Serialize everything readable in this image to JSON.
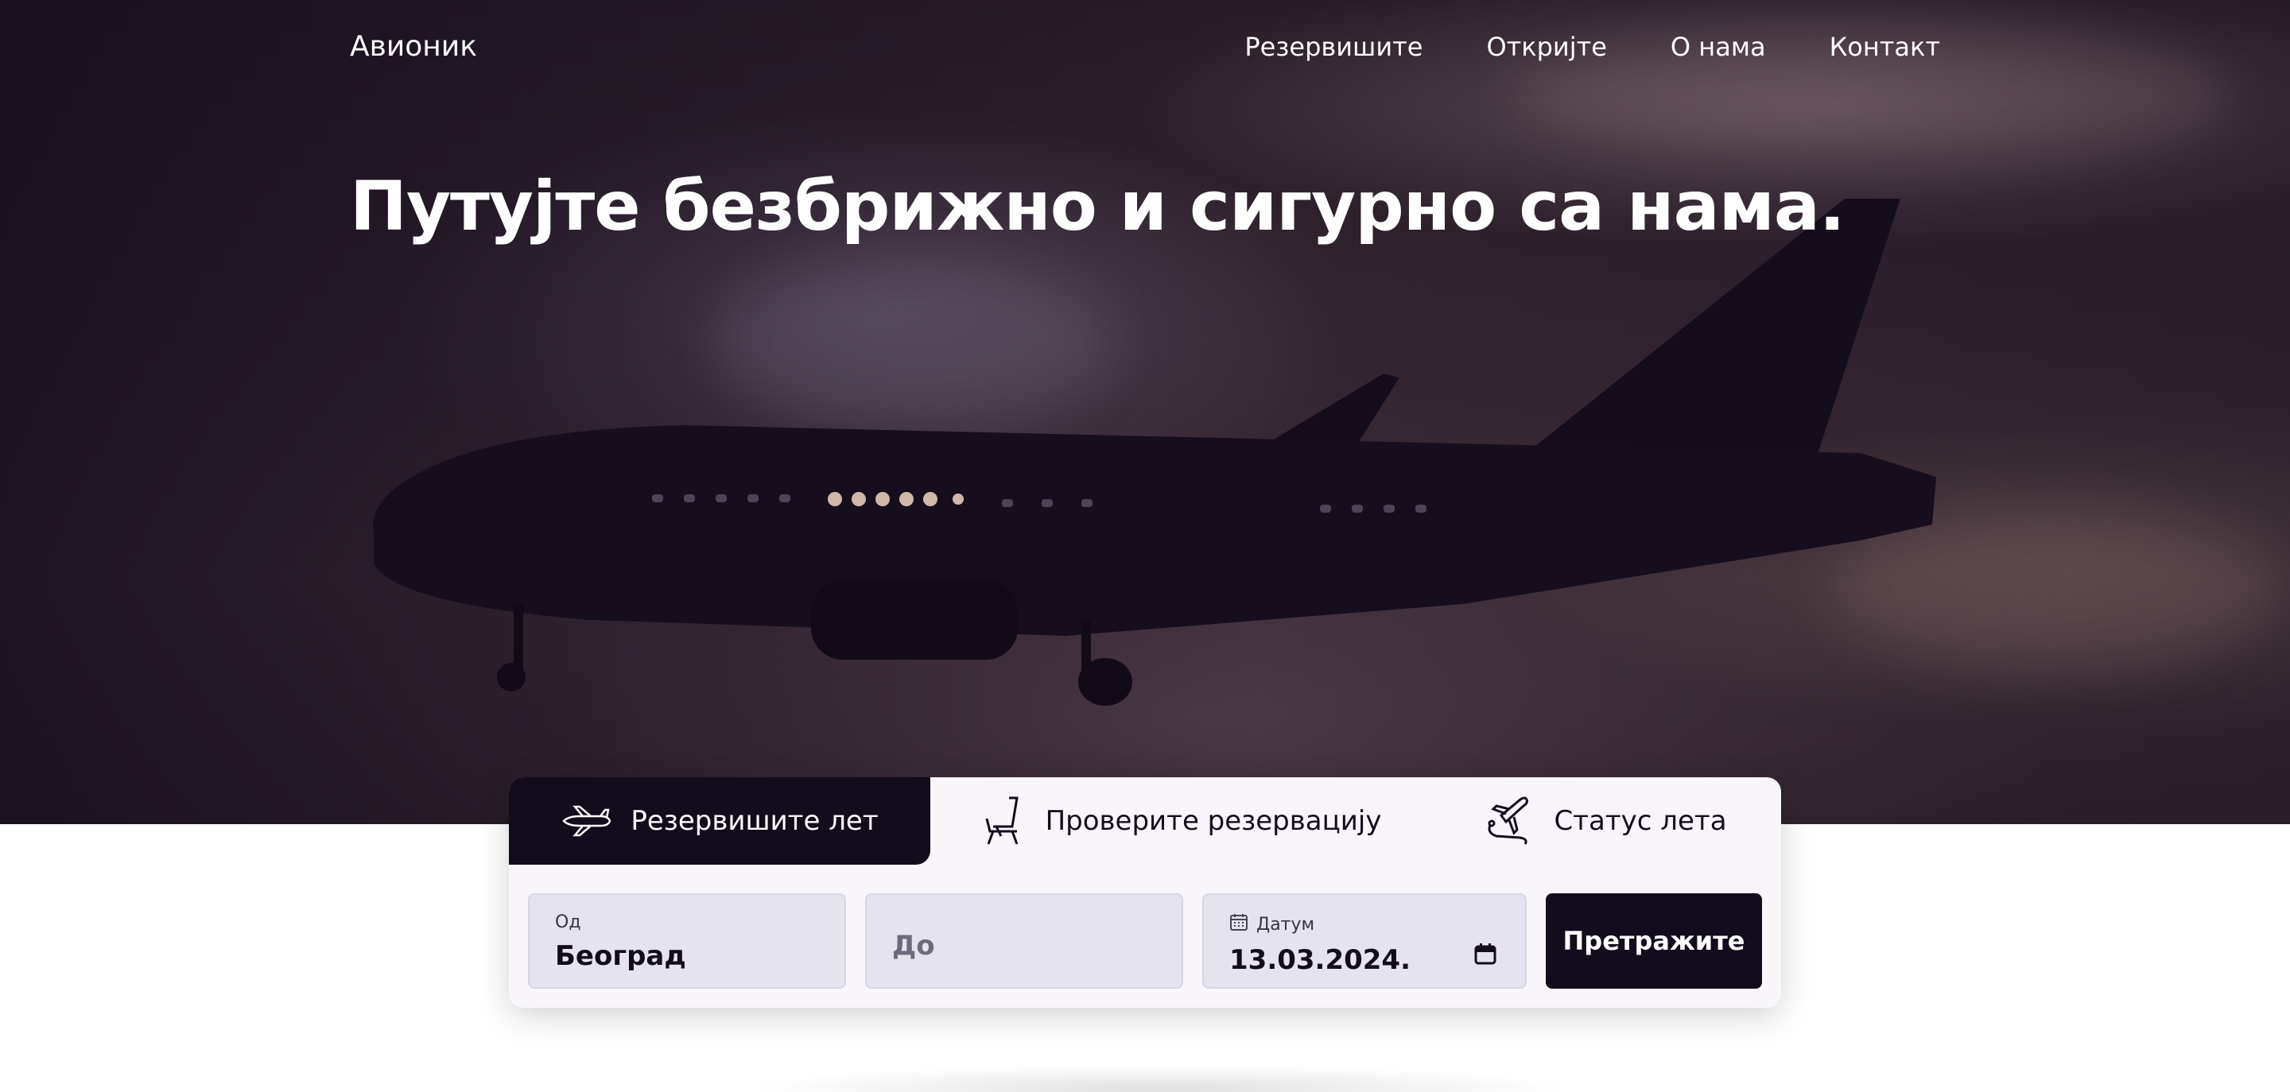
{
  "brand": {
    "logo_text": "Авионик"
  },
  "nav": {
    "items": [
      {
        "label": "Резервишите"
      },
      {
        "label": "Откријте"
      },
      {
        "label": "О нама"
      },
      {
        "label": "Контакт"
      }
    ]
  },
  "hero": {
    "headline": "Путујте безбрижно и сигурно са нама."
  },
  "booking": {
    "tabs": [
      {
        "label": "Резервишите лет",
        "icon": "airplane-icon",
        "active": true
      },
      {
        "label": "Проверите резервацију",
        "icon": "seat-icon",
        "active": false
      },
      {
        "label": "Статус лета",
        "icon": "flight-route-icon",
        "active": false
      }
    ],
    "from": {
      "label": "Од",
      "value": "Београд"
    },
    "to": {
      "placeholder": "До"
    },
    "date": {
      "label": "Датум",
      "value": "13.03.2024.",
      "icon": "calendar-icon"
    },
    "search_label": "Претражите",
    "swap_icon": "swap-arrows-icon"
  },
  "colors": {
    "dark": "#130c1c",
    "field_bg": "#e5e3ee",
    "card_bg": "#f8f6fb"
  }
}
